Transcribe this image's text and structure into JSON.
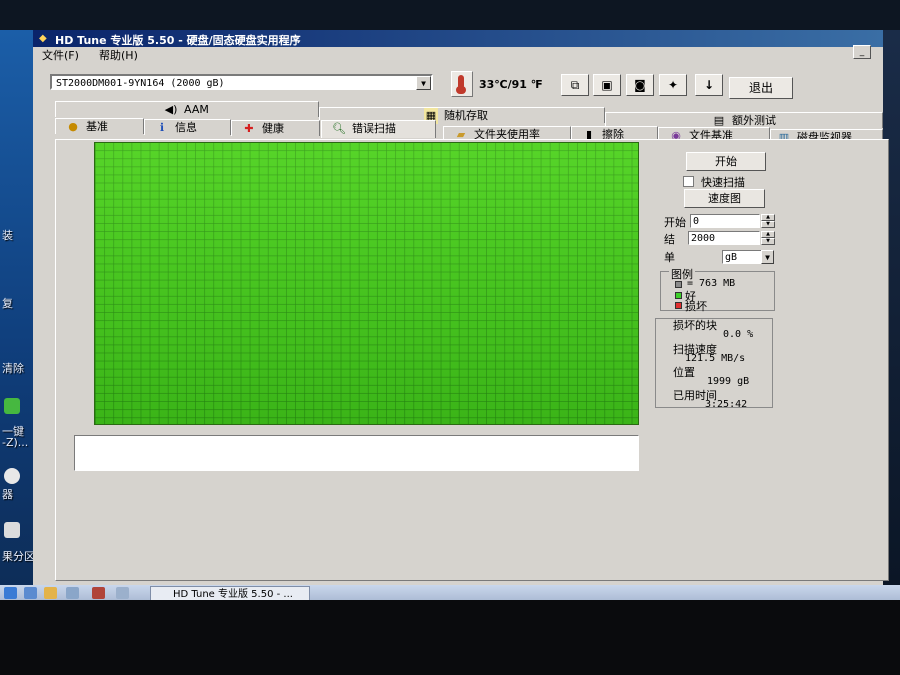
{
  "window": {
    "title": "HD Tune 专业版 5.50 - 硬盘/固态硬盘实用程序"
  },
  "menu": {
    "file": "文件(F)",
    "help": "帮助(H)"
  },
  "toolbar": {
    "drive": "ST2000DM001-9YN164 (2000 gB)",
    "temperature": "33℃/91 ℉",
    "exit_label": "退出",
    "icons": [
      "copy-icon",
      "save-icon",
      "camera-icon",
      "options-icon",
      "download-icon"
    ]
  },
  "tabs": {
    "row1": [
      {
        "label": "AAM",
        "icon": "speaker-icon"
      },
      {
        "label": "随机存取",
        "icon": "random-access-icon"
      },
      {
        "label": "额外测试",
        "icon": "extra-tests-icon"
      }
    ],
    "row2": [
      {
        "label": "基准",
        "icon": "benchmark-icon"
      },
      {
        "label": "信息",
        "icon": "info-icon"
      },
      {
        "label": "健康",
        "icon": "health-icon"
      },
      {
        "label": "错误扫描",
        "icon": "error-scan-icon",
        "active": true
      },
      {
        "label": "文件夹使用率",
        "icon": "folder-icon"
      },
      {
        "label": "擦除",
        "icon": "erase-icon"
      },
      {
        "label": "文件基准",
        "icon": "file-benchmark-icon"
      },
      {
        "label": "磁盘监视器",
        "icon": "disk-monitor-icon"
      }
    ]
  },
  "scan": {
    "start_button": "开始",
    "quick_scan_label": "快速扫描",
    "quick_scan_checked": false,
    "speed_map_button": "速度图",
    "start_label": "开始",
    "start_value": "0",
    "end_label": "结",
    "end_value": "2000",
    "unit_label": "单",
    "unit_value": "gB",
    "block_status": "all good"
  },
  "legend": {
    "title": "图例",
    "block_size": "= 763 MB",
    "good": "好",
    "damaged": "损坏",
    "colors": {
      "block": "#8a8a8a",
      "good": "#3ecf2a",
      "damaged": "#e03030"
    }
  },
  "stats": {
    "damaged_blocks_label": "损坏的块",
    "damaged_blocks_value": "0.0 %",
    "scan_speed_label": "扫描速度",
    "scan_speed_value": "121.5 MB/s",
    "position_label": "位置",
    "position_value": "1999 gB",
    "elapsed_label": "已用时间",
    "elapsed_value": "3:25:42"
  },
  "taskbar": {
    "task_label": "HD Tune 专业版 5.50 - ..."
  },
  "desktop": {
    "labels": [
      "装",
      "复",
      "清除",
      "一键",
      "-Z)...",
      "器",
      "果分区"
    ]
  }
}
